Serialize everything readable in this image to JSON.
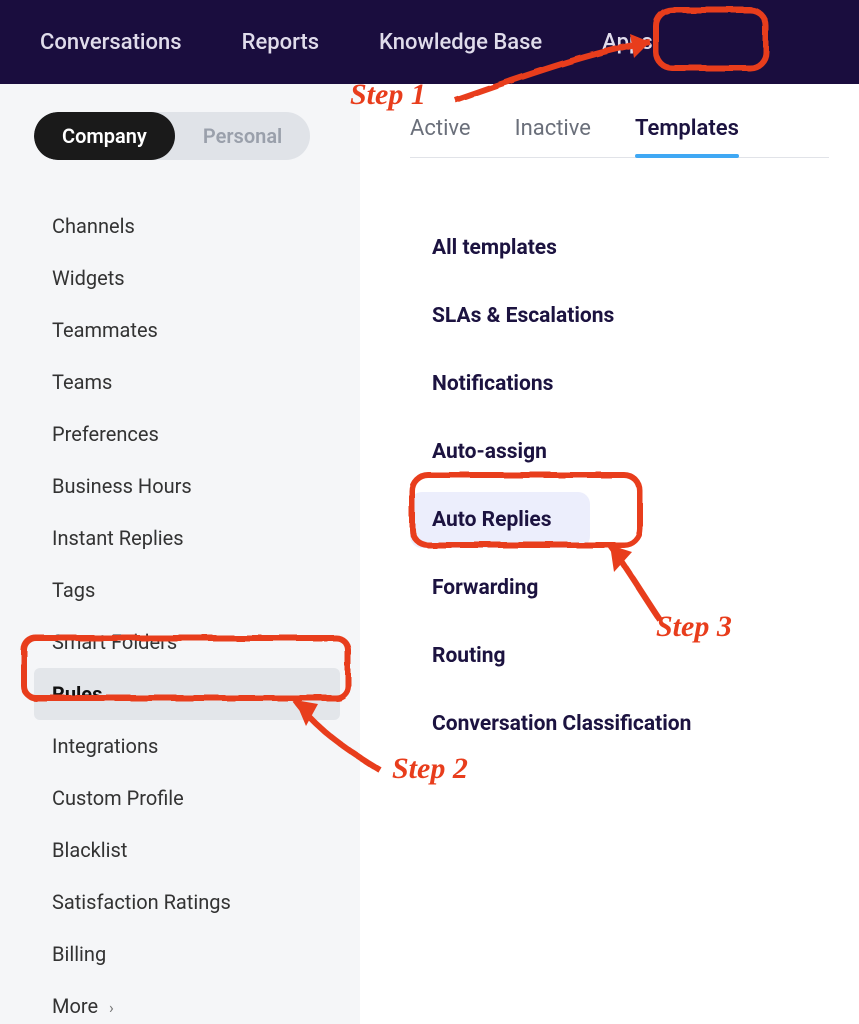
{
  "topnav": {
    "items": [
      {
        "label": "Conversations"
      },
      {
        "label": "Reports"
      },
      {
        "label": "Knowledge Base"
      },
      {
        "label": "Apps"
      }
    ]
  },
  "sidebar": {
    "toggle": {
      "company": "Company",
      "personal": "Personal"
    },
    "items": [
      {
        "label": "Channels"
      },
      {
        "label": "Widgets"
      },
      {
        "label": "Teammates"
      },
      {
        "label": "Teams"
      },
      {
        "label": "Preferences"
      },
      {
        "label": "Business Hours"
      },
      {
        "label": "Instant Replies"
      },
      {
        "label": "Tags"
      },
      {
        "label": "Smart Folders"
      },
      {
        "label": "Rules"
      },
      {
        "label": "Integrations"
      },
      {
        "label": "Custom Profile"
      },
      {
        "label": "Blacklist"
      },
      {
        "label": "Satisfaction Ratings"
      },
      {
        "label": "Billing"
      },
      {
        "label": "More"
      }
    ]
  },
  "tabs": {
    "items": [
      {
        "label": "Active"
      },
      {
        "label": "Inactive"
      },
      {
        "label": "Templates"
      }
    ]
  },
  "templates": {
    "items": [
      {
        "label": "All templates"
      },
      {
        "label": "SLAs & Escalations"
      },
      {
        "label": "Notifications"
      },
      {
        "label": "Auto-assign"
      },
      {
        "label": "Auto Replies"
      },
      {
        "label": "Forwarding"
      },
      {
        "label": "Routing"
      },
      {
        "label": "Conversation Classification"
      }
    ]
  },
  "annotations": {
    "step1": "Step 1",
    "step2": "Step 2",
    "step3": "Step 3"
  }
}
